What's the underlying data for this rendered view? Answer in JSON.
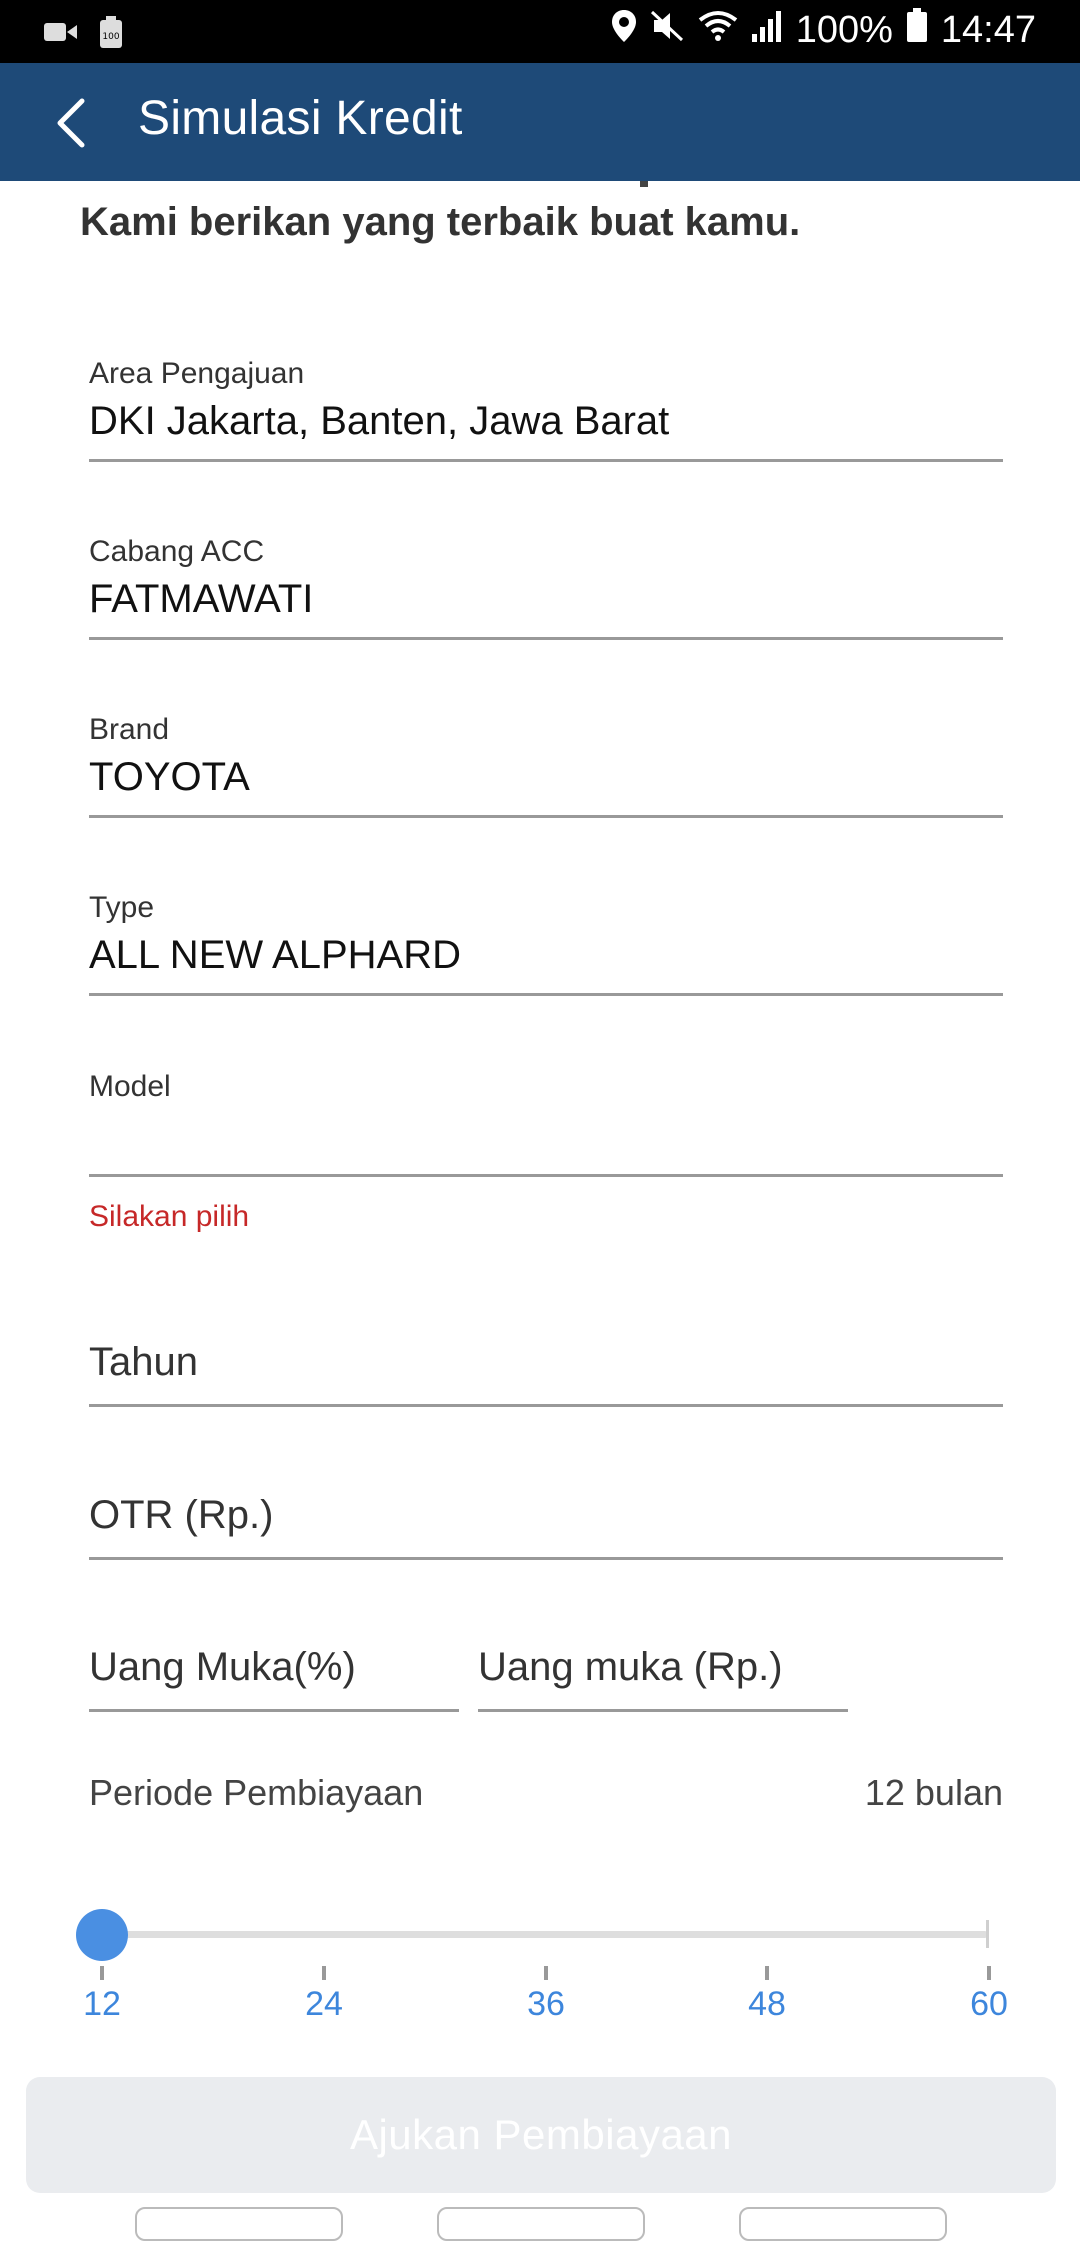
{
  "status_bar": {
    "battery_percent": "100%",
    "time": "14:47",
    "left_icons": [
      "video-icon",
      "battery-saver-icon"
    ],
    "right_icons": [
      "location-icon",
      "mute-icon",
      "wifi-icon",
      "signal-icon",
      "battery-icon"
    ]
  },
  "appbar": {
    "title": "Simulasi Kredit",
    "back_icon": "chevron-left-icon",
    "color": "#1e4a78"
  },
  "intro": {
    "tagline": "Kami berikan yang terbaik buat kamu."
  },
  "form": {
    "area": {
      "label": "Area Pengajuan",
      "value": "DKI Jakarta, Banten, Jawa Barat"
    },
    "cabang": {
      "label": "Cabang ACC",
      "value": "FATMAWATI"
    },
    "brand": {
      "label": "Brand",
      "value": "TOYOTA"
    },
    "type": {
      "label": "Type",
      "value": "ALL NEW ALPHARD"
    },
    "model": {
      "label": "Model",
      "value": "",
      "error": "Silakan pilih"
    },
    "tahun": {
      "placeholder": "Tahun"
    },
    "otr": {
      "placeholder": "OTR (Rp.)"
    },
    "uang_muka_pct": {
      "placeholder": "Uang Muka(%)"
    },
    "uang_muka_rp": {
      "placeholder": "Uang muka (Rp.)"
    },
    "periode": {
      "label": "Periode Pembiayaan",
      "value": "12 bulan",
      "selected": 12,
      "min": 12,
      "max": 60,
      "ticks": [
        "12",
        "24",
        "36",
        "48",
        "60"
      ]
    },
    "submit_label": "Ajukan Pembiayaan"
  },
  "colors": {
    "accent": "#4a8fe2",
    "error": "#c62828",
    "button_disabled": "#eaecef"
  }
}
